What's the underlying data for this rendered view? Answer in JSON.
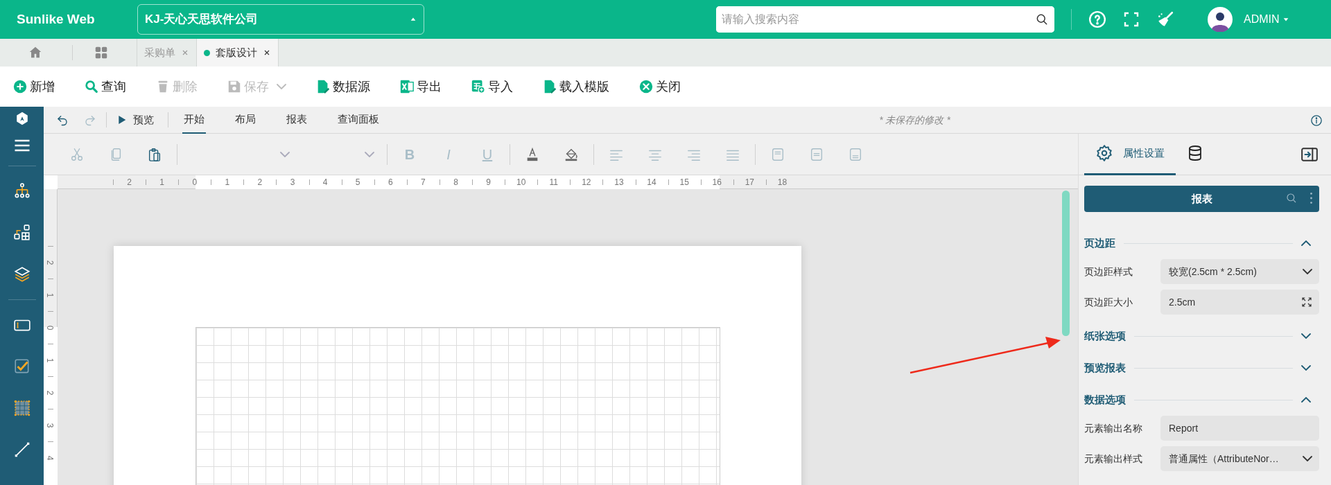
{
  "header": {
    "brand": "Sunlike Web",
    "company": "KJ-天心天思软件公司",
    "search": {
      "placeholder": "请输入搜索内容"
    },
    "user": "ADMIN"
  },
  "tabs": [
    {
      "label": "采购单",
      "selected": false
    },
    {
      "label": "套版设计",
      "selected": true
    }
  ],
  "toolbar": [
    {
      "kind": "add",
      "label": "新增",
      "disabled": false
    },
    {
      "kind": "query",
      "label": "查询",
      "disabled": false
    },
    {
      "kind": "delete",
      "label": "删除",
      "disabled": true
    },
    {
      "kind": "save",
      "label": "保存",
      "disabled": true,
      "dropdown": true
    },
    {
      "kind": "datasource",
      "label": "数据源",
      "disabled": false
    },
    {
      "kind": "export",
      "label": "导出",
      "disabled": false
    },
    {
      "kind": "import",
      "label": "导入",
      "disabled": false
    },
    {
      "kind": "template",
      "label": "载入模版",
      "disabled": false
    },
    {
      "kind": "close",
      "label": "关闭",
      "disabled": false
    }
  ],
  "editor_menu": {
    "history": [
      {
        "kind": "undo",
        "disabled": false
      },
      {
        "kind": "redo",
        "disabled": true
      }
    ],
    "preview": "预览",
    "ribbon_tabs": [
      {
        "label": "开始",
        "selected": true
      },
      {
        "label": "布局",
        "selected": false
      },
      {
        "label": "报表",
        "selected": false
      },
      {
        "label": "查询面板",
        "selected": false
      }
    ],
    "status": "* 未保存的修改 *"
  },
  "format_groups": [
    [
      {
        "kind": "cut",
        "disabled": true
      },
      {
        "kind": "copy",
        "disabled": true
      },
      {
        "kind": "paste",
        "disabled": false
      }
    ],
    [
      {
        "kind": "select",
        "disabled": true
      },
      {
        "kind": "select",
        "disabled": true
      }
    ],
    [
      {
        "kind": "bold",
        "glyph": "B",
        "disabled": true
      },
      {
        "kind": "italic",
        "glyph": "I",
        "disabled": true
      },
      {
        "kind": "underline",
        "glyph": "U",
        "disabled": true
      }
    ],
    [
      {
        "kind": "font-color",
        "disabled": false
      },
      {
        "kind": "fill",
        "disabled": false
      }
    ],
    [
      {
        "kind": "align-left",
        "disabled": true
      },
      {
        "kind": "align-center",
        "disabled": true
      },
      {
        "kind": "align-right",
        "disabled": true
      },
      {
        "kind": "justify",
        "disabled": true
      }
    ],
    [
      {
        "kind": "valign-top",
        "disabled": true
      },
      {
        "kind": "valign-middle",
        "disabled": true
      },
      {
        "kind": "valign-bottom",
        "disabled": true
      }
    ]
  ],
  "ruler": {
    "horizontal": [
      "2",
      "1",
      "0",
      "1",
      "2",
      "3",
      "4",
      "5",
      "6",
      "7",
      "8",
      "9",
      "10",
      "11",
      "12",
      "13",
      "14",
      "15",
      "16",
      "17",
      "18"
    ],
    "vertical": [
      "2",
      "1",
      "0",
      "1",
      "2",
      "3",
      "4"
    ]
  },
  "properties": {
    "tabs": [
      {
        "kind": "settings",
        "label": "属性设置",
        "selected": true
      },
      {
        "kind": "data",
        "selected": false
      }
    ],
    "object": "报表",
    "sections": [
      {
        "title": "页边距",
        "expanded": true,
        "fields": [
          {
            "kind": "select",
            "label": "页边距样式",
            "value": "较宽(2.5cm * 2.5cm)"
          },
          {
            "kind": "expand",
            "label": "页边距大小",
            "value": "2.5cm"
          }
        ]
      },
      {
        "title": "纸张选项",
        "expanded": false
      },
      {
        "title": "预览报表",
        "expanded": false
      },
      {
        "title": "数据选项",
        "expanded": true,
        "fields": [
          {
            "kind": "input",
            "label": "元素输出名称",
            "value": "Report"
          },
          {
            "kind": "select",
            "label": "元素输出样式",
            "value": "普通属性（AttributeNor…"
          }
        ]
      }
    ]
  }
}
